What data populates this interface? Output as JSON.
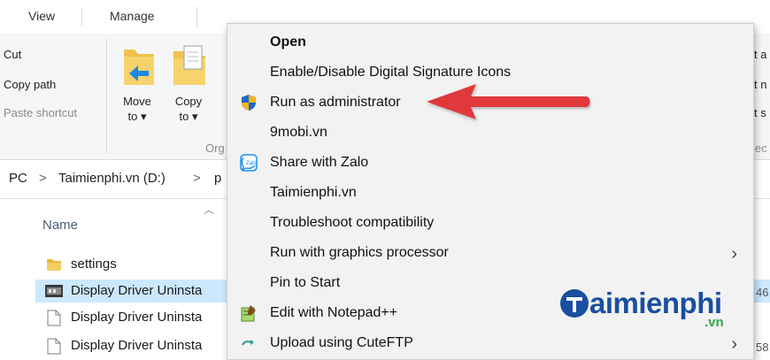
{
  "ribbon": {
    "tabs": [
      "View",
      "Manage"
    ],
    "clipboard": {
      "cut": "Cut",
      "copy_path": "Copy path",
      "paste_shortcut": "Paste shortcut"
    },
    "move_to": {
      "line1": "Move",
      "line2": "to ▾"
    },
    "copy_to": {
      "line1": "Copy",
      "line2": "to ▾"
    },
    "organize_fragment": "Org",
    "right_fragments": [
      "t a",
      "t n",
      "t s",
      "lec"
    ]
  },
  "address": {
    "pc": "PC",
    "sep": ">",
    "drive": "Taimienphi.vn (D:)",
    "next": "p"
  },
  "file_list": {
    "column_name": "Name",
    "rows": [
      {
        "name": "settings",
        "icon": "folder-icon",
        "selected": false
      },
      {
        "name": "Display Driver Uninsta",
        "icon": "app-icon",
        "selected": true
      },
      {
        "name": "Display Driver Uninsta",
        "icon": "file-icon",
        "selected": false
      },
      {
        "name": "Display Driver Uninsta",
        "icon": "file-icon",
        "selected": false
      }
    ],
    "right_values": [
      "46",
      "58"
    ]
  },
  "context_menu": {
    "items": [
      {
        "label": "Open",
        "bold": true,
        "icon": ""
      },
      {
        "label": "Enable/Disable Digital Signature Icons",
        "icon": ""
      },
      {
        "label": "Run as administrator",
        "icon": "uac-shield-icon"
      },
      {
        "label": "9mobi.vn",
        "icon": ""
      },
      {
        "label": "Share with Zalo",
        "icon": "zalo-icon"
      },
      {
        "label": "Taimienphi.vn",
        "icon": ""
      },
      {
        "label": "Troubleshoot compatibility",
        "icon": ""
      },
      {
        "label": "Run with graphics processor",
        "icon": "",
        "submenu": true
      },
      {
        "label": "Pin to Start",
        "icon": ""
      },
      {
        "label": "Edit with Notepad++",
        "icon": "notepadpp-icon"
      },
      {
        "label": "Upload using CuteFTP",
        "icon": "cuteftp-icon",
        "submenu": true
      }
    ]
  },
  "watermark": {
    "brand": "aimienphi",
    "tld": ".vn"
  },
  "colors": {
    "arrow": "#e0393b",
    "selection": "#cce8ff",
    "brand": "#1a4fa0"
  }
}
